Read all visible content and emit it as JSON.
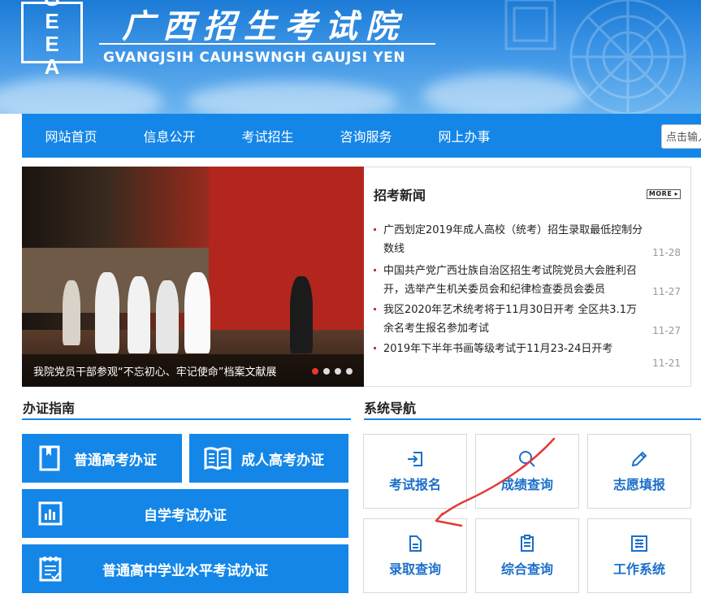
{
  "header": {
    "logo_letters": [
      "G",
      "E",
      "E",
      "A"
    ],
    "title": "广西招生考试院",
    "subtitle": "GVANGJSIH CAUHSWNGH GAUJSI YEN"
  },
  "nav": {
    "items": [
      "网站首页",
      "信息公开",
      "考试招生",
      "咨询服务",
      "网上办事"
    ],
    "search_placeholder": "点击输入"
  },
  "carousel": {
    "caption": "我院党员干部参观“不忘初心、牢记使命”档案文献展",
    "dot_count": 4,
    "active_index": 0
  },
  "news": {
    "title": "招考新闻",
    "more_label": "MORE",
    "items": [
      {
        "text": "广西划定2019年成人高校（统考）招生录取最低控制分数线",
        "date": "11-28"
      },
      {
        "text": "中国共产党广西壮族自治区招生考试院党员大会胜利召开，选举产生机关委员会和纪律检查委员会委员",
        "date": "11-27"
      },
      {
        "text": "我区2020年艺术统考将于11月30日开考 全区共3.1万余名考生报名参加考试",
        "date": "11-27"
      },
      {
        "text": "2019年下半年书画等级考试于11月23-24日开考",
        "date": "11-21"
      }
    ]
  },
  "guide": {
    "title": "办证指南",
    "buttons": [
      "普通高考办证",
      "成人高考办证",
      "自学考试办证",
      "普通高中学业水平考试办证"
    ]
  },
  "system": {
    "title": "系统导航",
    "tiles": [
      "考试报名",
      "成绩查询",
      "志愿填报",
      "录取查询",
      "综合查询",
      "工作系统"
    ]
  },
  "colors": {
    "primary": "#1486e8",
    "tile_text": "#1a6fc9",
    "annotation": "#e53935"
  }
}
